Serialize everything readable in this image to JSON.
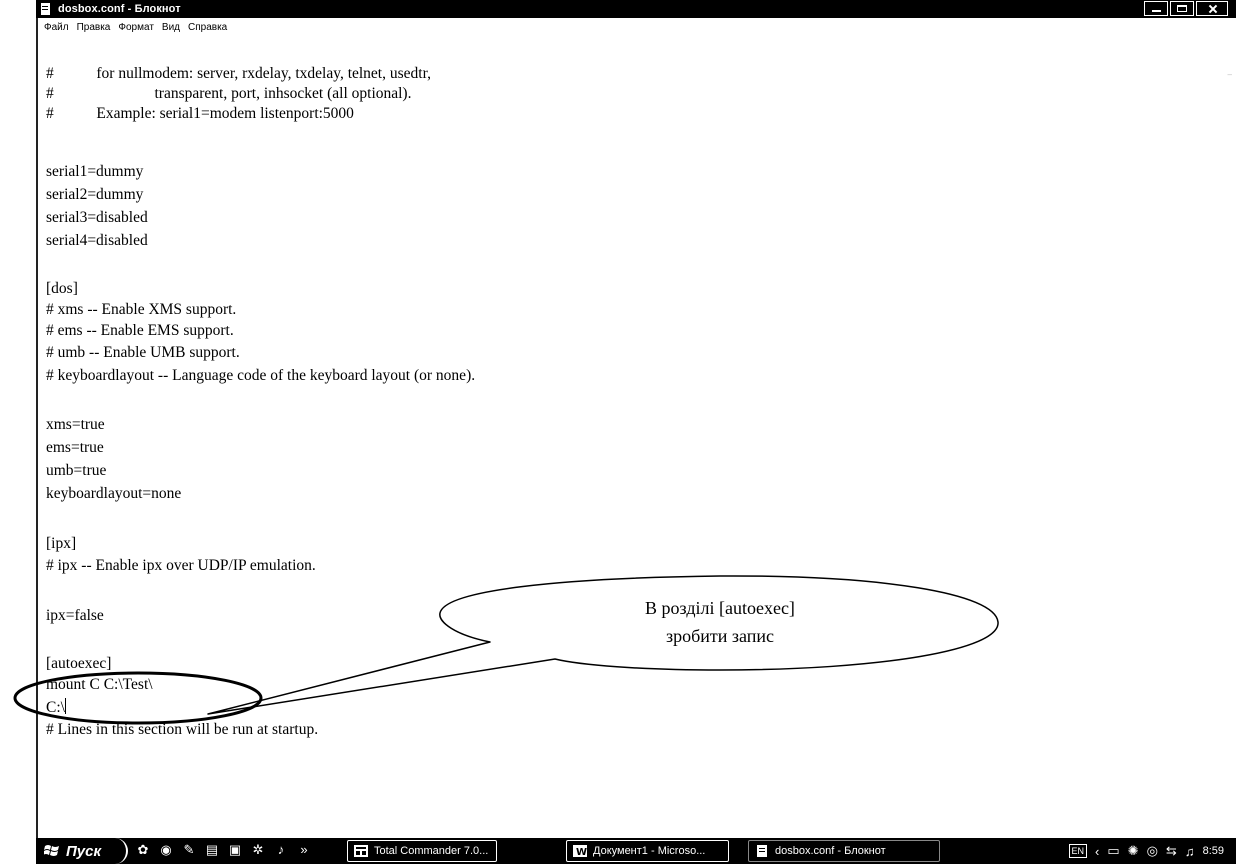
{
  "window": {
    "title": "dosbox.conf - Блокнот"
  },
  "menu": [
    "Файл",
    "Правка",
    "Формат",
    "Вид",
    "Справка"
  ],
  "editor": {
    "lines": [
      "#           for nullmodem: server, rxdelay, txdelay, telnet, usedtr,",
      "#                          transparent, port, inhsocket (all optional).",
      "#           Example: serial1=modem listenport:5000",
      "",
      "serial1=dummy",
      "serial2=dummy",
      "serial3=disabled",
      "serial4=disabled",
      "",
      "[dos]",
      "# xms -- Enable XMS support.",
      "# ems -- Enable EMS support.",
      "# umb -- Enable UMB support.",
      "# keyboardlayout -- Language code of the keyboard layout (or none).",
      "",
      "xms=true",
      "ems=true",
      "umb=true",
      "keyboardlayout=none",
      "",
      "[ipx]",
      "# ipx -- Enable ipx over UDP/IP emulation.",
      "",
      "ipx=false",
      "",
      "[autoexec]",
      "mount C C:\\Test\\",
      "C:\\",
      "# Lines in this section will be run at startup."
    ]
  },
  "callout": {
    "line1": "В розділі [autoexec]",
    "line2": "зробити запис"
  },
  "taskbar": {
    "start_label": "Пуск",
    "more": "»",
    "tasks": [
      "Total Commander 7.0...",
      "Документ1 - Microso...",
      "dosbox.conf - Блокнот"
    ],
    "lang": "EN",
    "clock": "8:59"
  }
}
